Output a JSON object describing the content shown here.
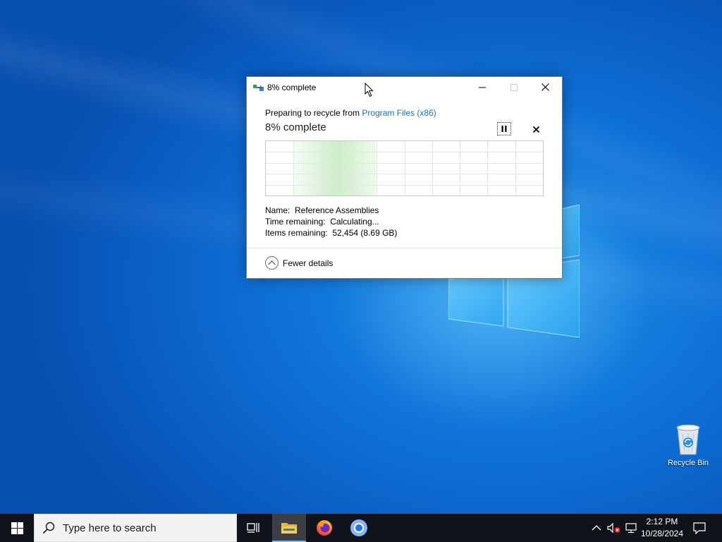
{
  "dialog": {
    "title": "8% complete",
    "source_prefix": "Preparing to recycle from ",
    "source_link": "Program Files (x86)",
    "progress_heading": "8% complete",
    "progress_fraction": 0.08,
    "details": {
      "name_label": "Name:",
      "name_value": "Reference Assemblies",
      "time_label": "Time remaining:",
      "time_value": "Calculating...",
      "items_label": "Items remaining:",
      "items_value": "52,454 (8.69 GB)"
    },
    "footer_label": "Fewer details",
    "accent": "#1a6fb5",
    "graph_fill": "#c9ecc4"
  },
  "desktop": {
    "recycle_bin_label": "Recycle Bin"
  },
  "taskbar": {
    "search_placeholder": "Type here to search",
    "clock_time": "2:12 PM",
    "clock_date": "10/28/2024",
    "background": "#101319"
  },
  "icons": {
    "start": "windows-logo-icon",
    "search": "search-icon",
    "taskview": "task-view-icon",
    "explorer": "folder-icon",
    "firefox": "firefox-icon",
    "chrome": "chrome-icon",
    "tray_chevron": "chevron-up-icon",
    "volume": "volume-muted-icon",
    "network": "network-icon",
    "notifications": "notification-icon"
  }
}
